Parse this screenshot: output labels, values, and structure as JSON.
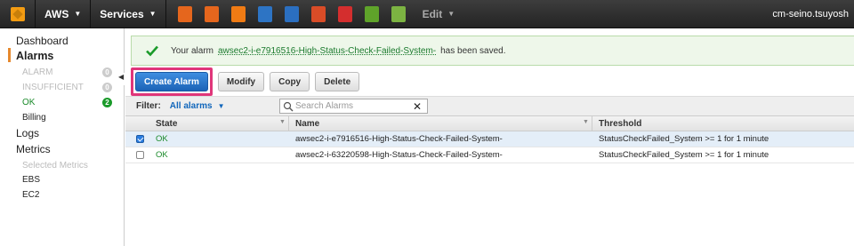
{
  "topbar": {
    "brand": "AWS",
    "services": "Services",
    "edit": "Edit",
    "user": "cm-seino.tsuyosh",
    "service_icons": [
      {
        "name": "flag-icon",
        "color": "#e5661d"
      },
      {
        "name": "chip-icon",
        "color": "#e5661d"
      },
      {
        "name": "hexagon-icon",
        "color": "#f07b14"
      },
      {
        "name": "arrows-icon",
        "color": "#2d74c4"
      },
      {
        "name": "database-icon",
        "color": "#2b6fc0"
      },
      {
        "name": "server-icon",
        "color": "#d94c27"
      },
      {
        "name": "book-icon",
        "color": "#d42e2e"
      },
      {
        "name": "cube-icon",
        "color": "#5fa32a"
      },
      {
        "name": "bulb-icon",
        "color": "#7cb342"
      }
    ]
  },
  "sidebar": {
    "dashboard": "Dashboard",
    "alarms": "Alarms",
    "alarm_states": [
      {
        "label": "ALARM",
        "count": "0"
      },
      {
        "label": "INSUFFICIENT",
        "count": "0"
      },
      {
        "label": "OK",
        "count": "2"
      }
    ],
    "billing": "Billing",
    "logs": "Logs",
    "metrics": "Metrics",
    "selected_metrics": "Selected Metrics",
    "ebs": "EBS",
    "ec2": "EC2"
  },
  "flash": {
    "prefix": "Your alarm",
    "alarm_name": "awsec2-i-e7916516-High-Status-Check-Failed-System-",
    "suffix": "has been saved."
  },
  "toolbar": {
    "create": "Create Alarm",
    "modify": "Modify",
    "copy": "Copy",
    "delete": "Delete"
  },
  "filter": {
    "label": "Filter:",
    "selected": "All alarms",
    "search_placeholder": "Search Alarms"
  },
  "table": {
    "columns": [
      "State",
      "Name",
      "Threshold"
    ],
    "rows": [
      {
        "checked": true,
        "state": "OK",
        "name": "awsec2-i-e7916516-High-Status-Check-Failed-System-",
        "threshold": "StatusCheckFailed_System >= 1 for 1 minute"
      },
      {
        "checked": false,
        "state": "OK",
        "name": "awsec2-i-63220598-High-Status-Check-Failed-System-",
        "threshold": "StatusCheckFailed_System >= 1 for 1 minute"
      }
    ]
  },
  "colors": {
    "accent_orange": "#e6892e",
    "ok_green": "#1a8a2a",
    "primary_blue": "#1c63b7",
    "highlight_pink": "#e0367a"
  }
}
